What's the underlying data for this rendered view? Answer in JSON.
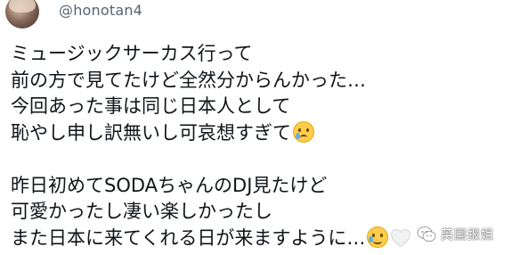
{
  "post": {
    "handle": "@honotan4",
    "lines": [
      "ミュージックサーカス行って",
      "前の方で見てたけど全然分からんかった…",
      "今回あった事は同じ日本人として",
      "恥やし申し訳無いし可哀想すぎて",
      "昨日初めてSODAちゃんのDJ見たけど",
      "可愛かったし凄い楽しかったし",
      "また日本に来てくれる日が来ますように…"
    ],
    "emojis": {
      "line4": "crying-face-icon",
      "line7_a": "smiling-face-with-tear-icon",
      "line7_b": "white-heart-icon"
    }
  },
  "watermark": {
    "text": "英国报姐"
  },
  "colors": {
    "text": "#0f1419",
    "handle": "#536471",
    "background": "#ffffff"
  }
}
